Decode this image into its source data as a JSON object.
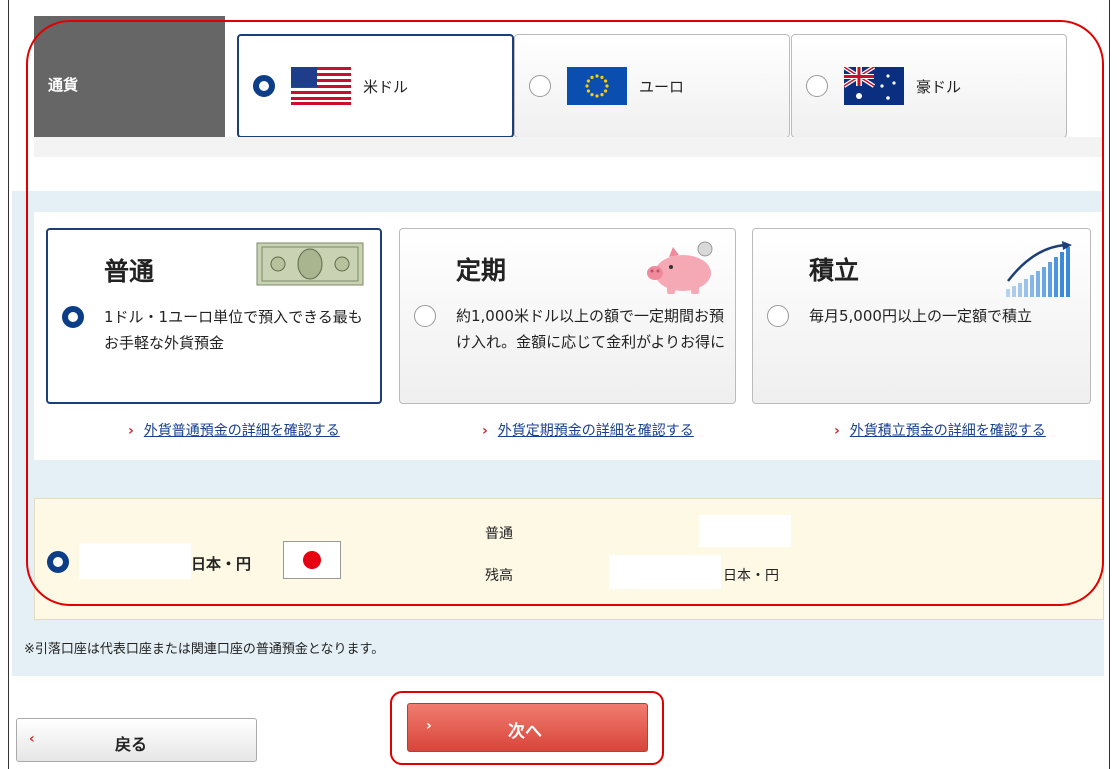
{
  "currency": {
    "label": "通貨",
    "options": [
      {
        "label": "米ドル",
        "flag": "us-flag-icon",
        "selected": true
      },
      {
        "label": "ユーロ",
        "flag": "eu-flag-icon",
        "selected": false
      },
      {
        "label": "豪ドル",
        "flag": "au-flag-icon",
        "selected": false
      }
    ]
  },
  "products": [
    {
      "title": "普通",
      "desc": "1ドル・1ユーロ単位で預入できる最もお手軽な外貨預金",
      "link": "外貨普通預金の詳細を確認する",
      "illustration": "dollar-bill-icon",
      "selected": true
    },
    {
      "title": "定期",
      "desc": "約1,000米ドル以上の額で一定期間お預け入れ。金額に応じて金利がよりお得に",
      "link": "外貨定期預金の詳細を確認する",
      "illustration": "piggy-bank-icon",
      "selected": false
    },
    {
      "title": "積立",
      "desc": "毎月5,000円以上の一定額で積立",
      "link": "外貨積立預金の詳細を確認する",
      "illustration": "growth-bars-icon",
      "selected": false
    }
  ],
  "account": {
    "currency_label": "日本・円",
    "type_label": "普通",
    "balance_label": "残高",
    "balance_unit": "日本・円"
  },
  "note": "※引落口座は代表口座または関連口座の普通預金となります。",
  "buttons": {
    "back": "戻る",
    "next": "次へ"
  },
  "colors": {
    "accent": "#0b3e86",
    "highlight": "#e00000",
    "next_button": "#e25a4e"
  }
}
